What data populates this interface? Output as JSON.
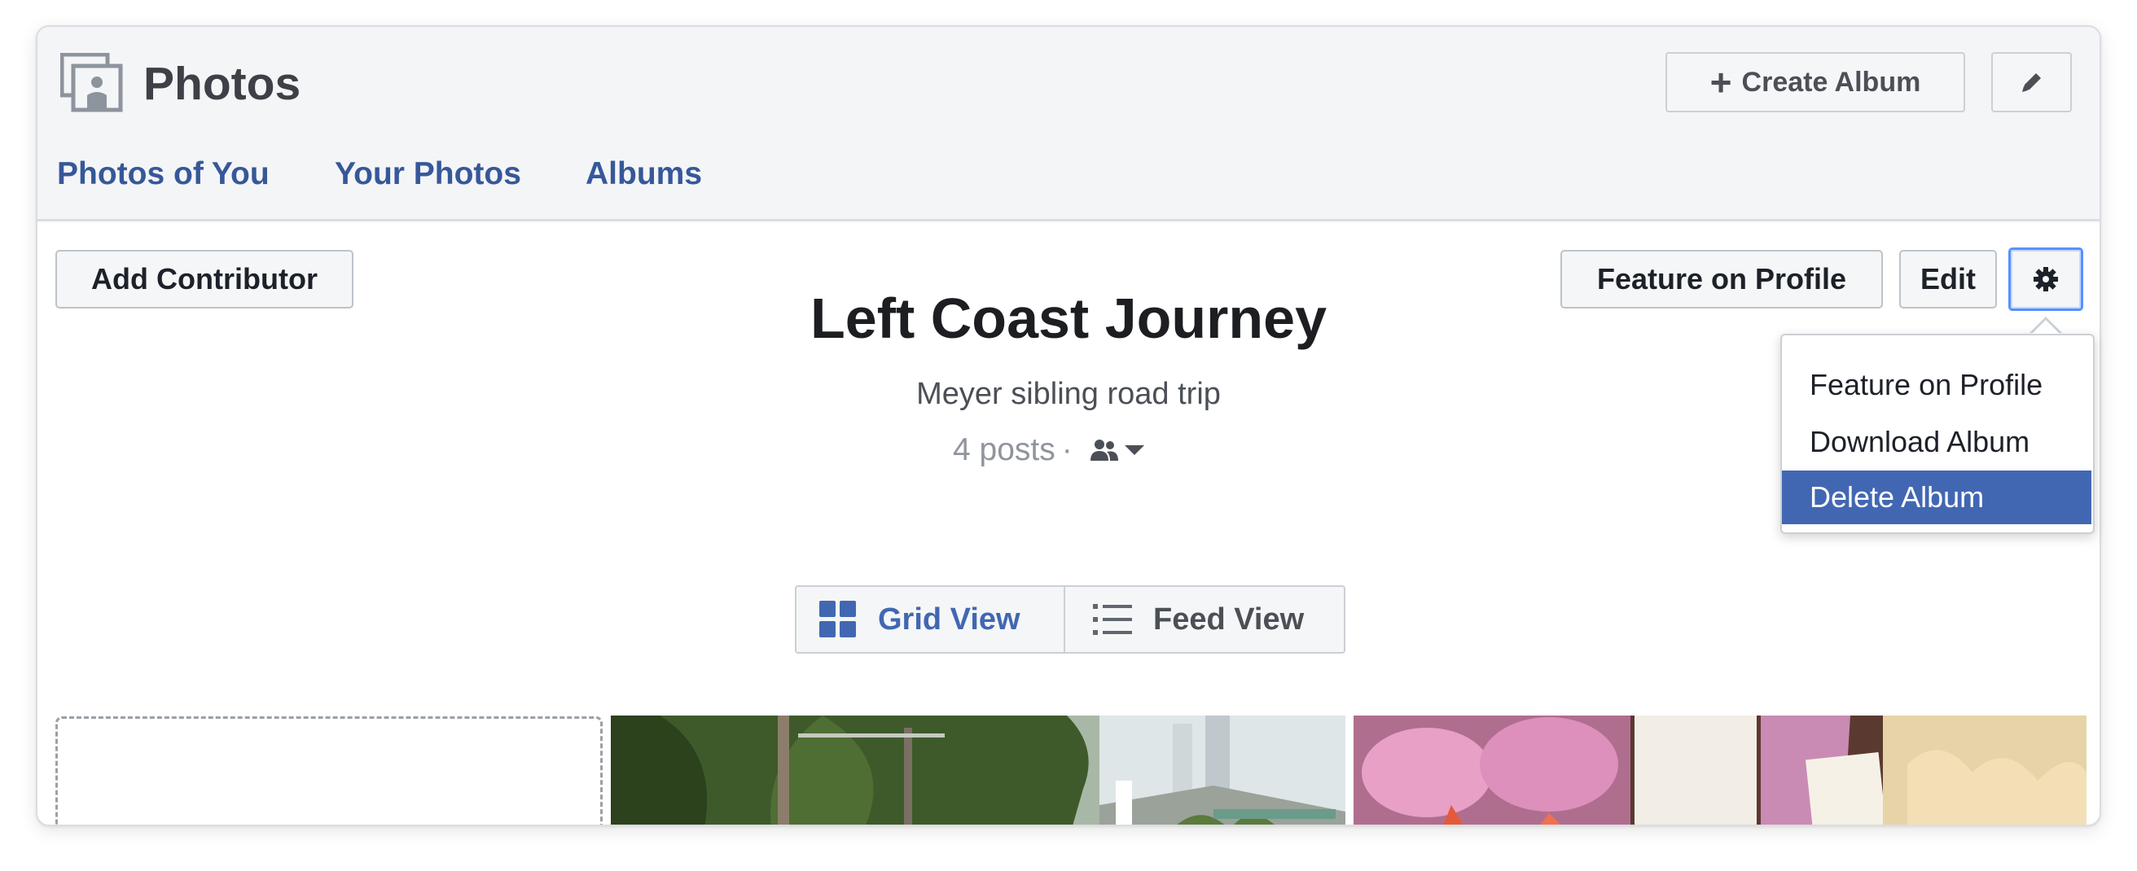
{
  "header": {
    "title": "Photos",
    "create_album_label": "Create Album",
    "create_album_icon": "plus-icon",
    "edit_icon": "pencil-icon",
    "tabs": [
      {
        "label": "Photos of You"
      },
      {
        "label": "Your Photos"
      },
      {
        "label": "Albums"
      }
    ]
  },
  "album": {
    "add_contributor_label": "Add Contributor",
    "feature_label": "Feature on Profile",
    "edit_label": "Edit",
    "settings_icon": "gear-icon",
    "title": "Left Coast Journey",
    "description": "Meyer sibling road trip",
    "posts": "4 posts",
    "meta_separator": "·",
    "audience_icon": "friends-icon"
  },
  "menu": {
    "items": [
      {
        "label": "Feature on Profile",
        "highlighted": false
      },
      {
        "label": "Download Album",
        "highlighted": false
      },
      {
        "label": "Delete Album",
        "highlighted": true
      }
    ]
  },
  "view_toggle": {
    "grid_label": "Grid View",
    "feed_label": "Feed View",
    "selected": "Grid View"
  },
  "colors": {
    "link_blue": "#365899",
    "accent_blue": "#4267b2",
    "focus_ring": "#5890ff"
  }
}
